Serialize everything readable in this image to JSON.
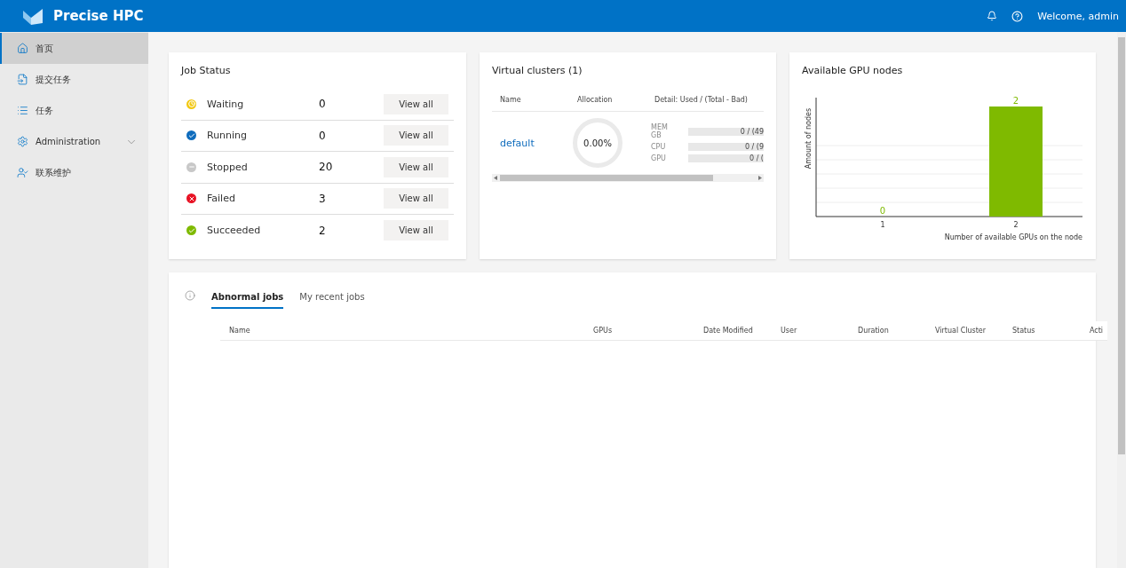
{
  "header": {
    "title": "Precise HPC",
    "welcome": "Welcome, admin"
  },
  "sidebar": {
    "items": [
      {
        "label": "首页",
        "selected": true
      },
      {
        "label": "提交任务",
        "selected": false
      },
      {
        "label": "任务",
        "selected": false
      },
      {
        "label": "Administration",
        "selected": false,
        "expandable": true
      },
      {
        "label": "联系维护",
        "selected": false
      }
    ]
  },
  "job_status": {
    "title": "Job Status",
    "rows": [
      {
        "kind": "waiting",
        "label": "Waiting",
        "count": "0",
        "button": "View all",
        "color": "#f2c811"
      },
      {
        "kind": "running",
        "label": "Running",
        "count": "0",
        "button": "View all",
        "color": "#0f6cbd"
      },
      {
        "kind": "stopped",
        "label": "Stopped",
        "count": "20",
        "button": "View all",
        "color": "#c8c8c8"
      },
      {
        "kind": "failed",
        "label": "Failed",
        "count": "3",
        "button": "View all",
        "color": "#e81123"
      },
      {
        "kind": "succeeded",
        "label": "Succeeded",
        "count": "2",
        "button": "View all",
        "color": "#7fba00"
      }
    ]
  },
  "virtual_clusters": {
    "title": "Virtual clusters (1)",
    "columns": [
      "Name",
      "Allocation",
      "Detail: Used / (Total - Bad)"
    ],
    "rows": [
      {
        "name": "default",
        "allocation": "0.00%",
        "details": [
          {
            "label": "MEM GB",
            "value": "0 / (49",
            "level": 0
          },
          {
            "label": "CPU",
            "value": "0 / (9",
            "level": 0
          },
          {
            "label": "GPU",
            "value": "0 / (",
            "level": 0
          }
        ]
      }
    ]
  },
  "gpu_nodes": {
    "title": "Available GPU nodes",
    "chart_data": {
      "type": "bar",
      "xlabel": "Number of available GPUs on the node",
      "ylabel": "Amount of nodes",
      "categories": [
        "1",
        "2"
      ],
      "series": [
        {
          "color": "#7fba00",
          "values": [
            0,
            2
          ]
        }
      ],
      "data_labels": true
    }
  },
  "jobs": {
    "tabs": [
      {
        "label": "Abnormal jobs",
        "selected": true
      },
      {
        "label": "My recent jobs",
        "selected": false
      }
    ],
    "columns": [
      "Name",
      "GPUs",
      "Date Modified",
      "User",
      "Duration",
      "Virtual Cluster",
      "Status",
      "Acti"
    ]
  }
}
